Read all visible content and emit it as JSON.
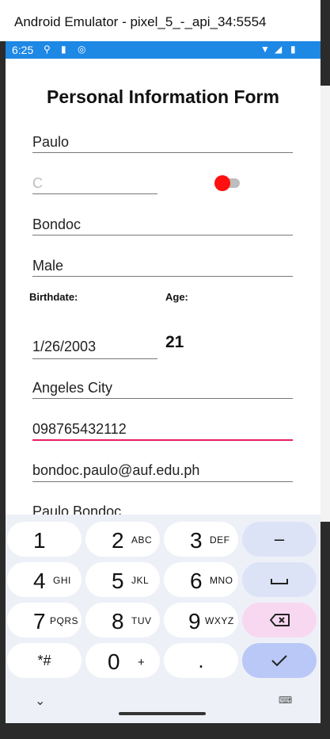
{
  "window": {
    "title": "Android Emulator - pixel_5_-_api_34:5554"
  },
  "status_bar": {
    "time": "6:25"
  },
  "form": {
    "title": "Personal Information Form",
    "first_name": "Paulo",
    "middle_initial_placeholder": "C",
    "last_name": "Bondoc",
    "gender": "Male",
    "birthdate_label": "Birthdate:",
    "age_label": "Age:",
    "birthdate": "1/26/2003",
    "age": "21",
    "address": "Angeles City",
    "phone": "098765432112",
    "email": "bondoc.paulo@auf.edu.ph",
    "partial_next": "Paulo Bondoc",
    "toggle": {
      "on": true,
      "thumb_color": "#ff1010"
    }
  },
  "keyboard": {
    "keys": [
      {
        "num": "1",
        "sub": ""
      },
      {
        "num": "2",
        "sub": "ABC"
      },
      {
        "num": "3",
        "sub": "DEF"
      },
      {
        "num": "4",
        "sub": "GHI"
      },
      {
        "num": "5",
        "sub": "JKL"
      },
      {
        "num": "6",
        "sub": "MNO"
      },
      {
        "num": "7",
        "sub": "PQRS"
      },
      {
        "num": "8",
        "sub": "TUV"
      },
      {
        "num": "9",
        "sub": "WXYZ"
      },
      {
        "num": "*#",
        "sub": ""
      },
      {
        "num": "0",
        "sub": "+"
      },
      {
        "num": ".",
        "sub": ""
      }
    ],
    "minus": "–",
    "space_icon": "space-icon",
    "backspace_icon": "backspace-icon",
    "done_icon": "check-icon"
  },
  "colors": {
    "status_bar": "#1e88e5",
    "focus_underline": "#e91e63",
    "accent_key": "#b9c8f6"
  }
}
